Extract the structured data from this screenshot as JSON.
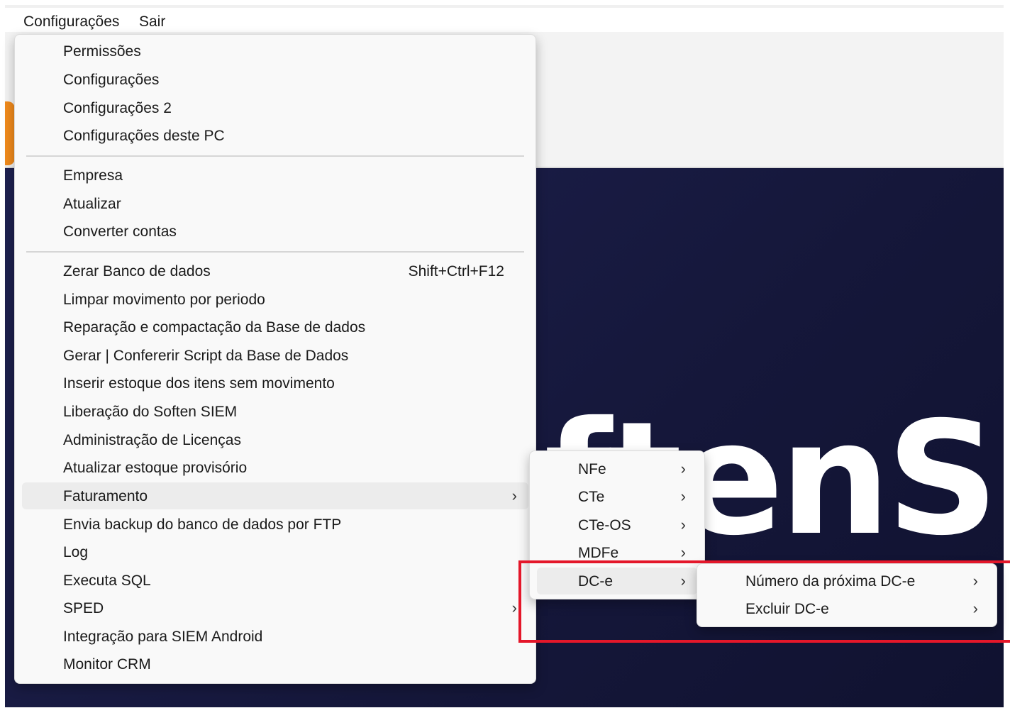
{
  "menubar": {
    "items": [
      "Configurações",
      "Sair"
    ]
  },
  "background": {
    "logo_text": "ftenSIEM",
    "logo_color": "#f08a1c"
  },
  "main_menu": {
    "items": [
      {
        "label": "Permissões"
      },
      {
        "label": "Configurações"
      },
      {
        "label": "Configurações 2"
      },
      {
        "label": "Configurações deste PC"
      },
      {
        "label": "Empresa"
      },
      {
        "label": "Atualizar"
      },
      {
        "label": "Converter contas"
      },
      {
        "label": "Zerar Banco de dados",
        "shortcut": "Shift+Ctrl+F12"
      },
      {
        "label": "Limpar movimento por periodo"
      },
      {
        "label": "Reparação e compactação da Base de dados"
      },
      {
        "label": "Gerar | Confererir Script da Base de Dados"
      },
      {
        "label": "Inserir estoque dos itens sem movimento"
      },
      {
        "label": "Liberação do Soften SIEM"
      },
      {
        "label": "Administração de Licenças"
      },
      {
        "label": "Atualizar estoque provisório"
      },
      {
        "label": "Faturamento",
        "submenu": true,
        "highlighted": true
      },
      {
        "label": "Envia backup do banco de dados por FTP"
      },
      {
        "label": "Log"
      },
      {
        "label": "Executa SQL"
      },
      {
        "label": "SPED",
        "submenu": true
      },
      {
        "label": "Integração para SIEM Android"
      },
      {
        "label": "Monitor CRM"
      }
    ],
    "chevron": "›"
  },
  "faturamento_menu": {
    "items": [
      {
        "label": "NFe",
        "submenu": true
      },
      {
        "label": "CTe",
        "submenu": true
      },
      {
        "label": "CTe-OS",
        "submenu": true
      },
      {
        "label": "MDFe",
        "submenu": true
      },
      {
        "label": "DC-e",
        "submenu": true,
        "highlighted": true
      }
    ]
  },
  "dce_menu": {
    "items": [
      {
        "label": "Número da próxima DC-e",
        "submenu": true
      },
      {
        "label": "Excluir DC-e",
        "submenu": true
      }
    ]
  },
  "annotation": {
    "color": "#e4172a"
  }
}
